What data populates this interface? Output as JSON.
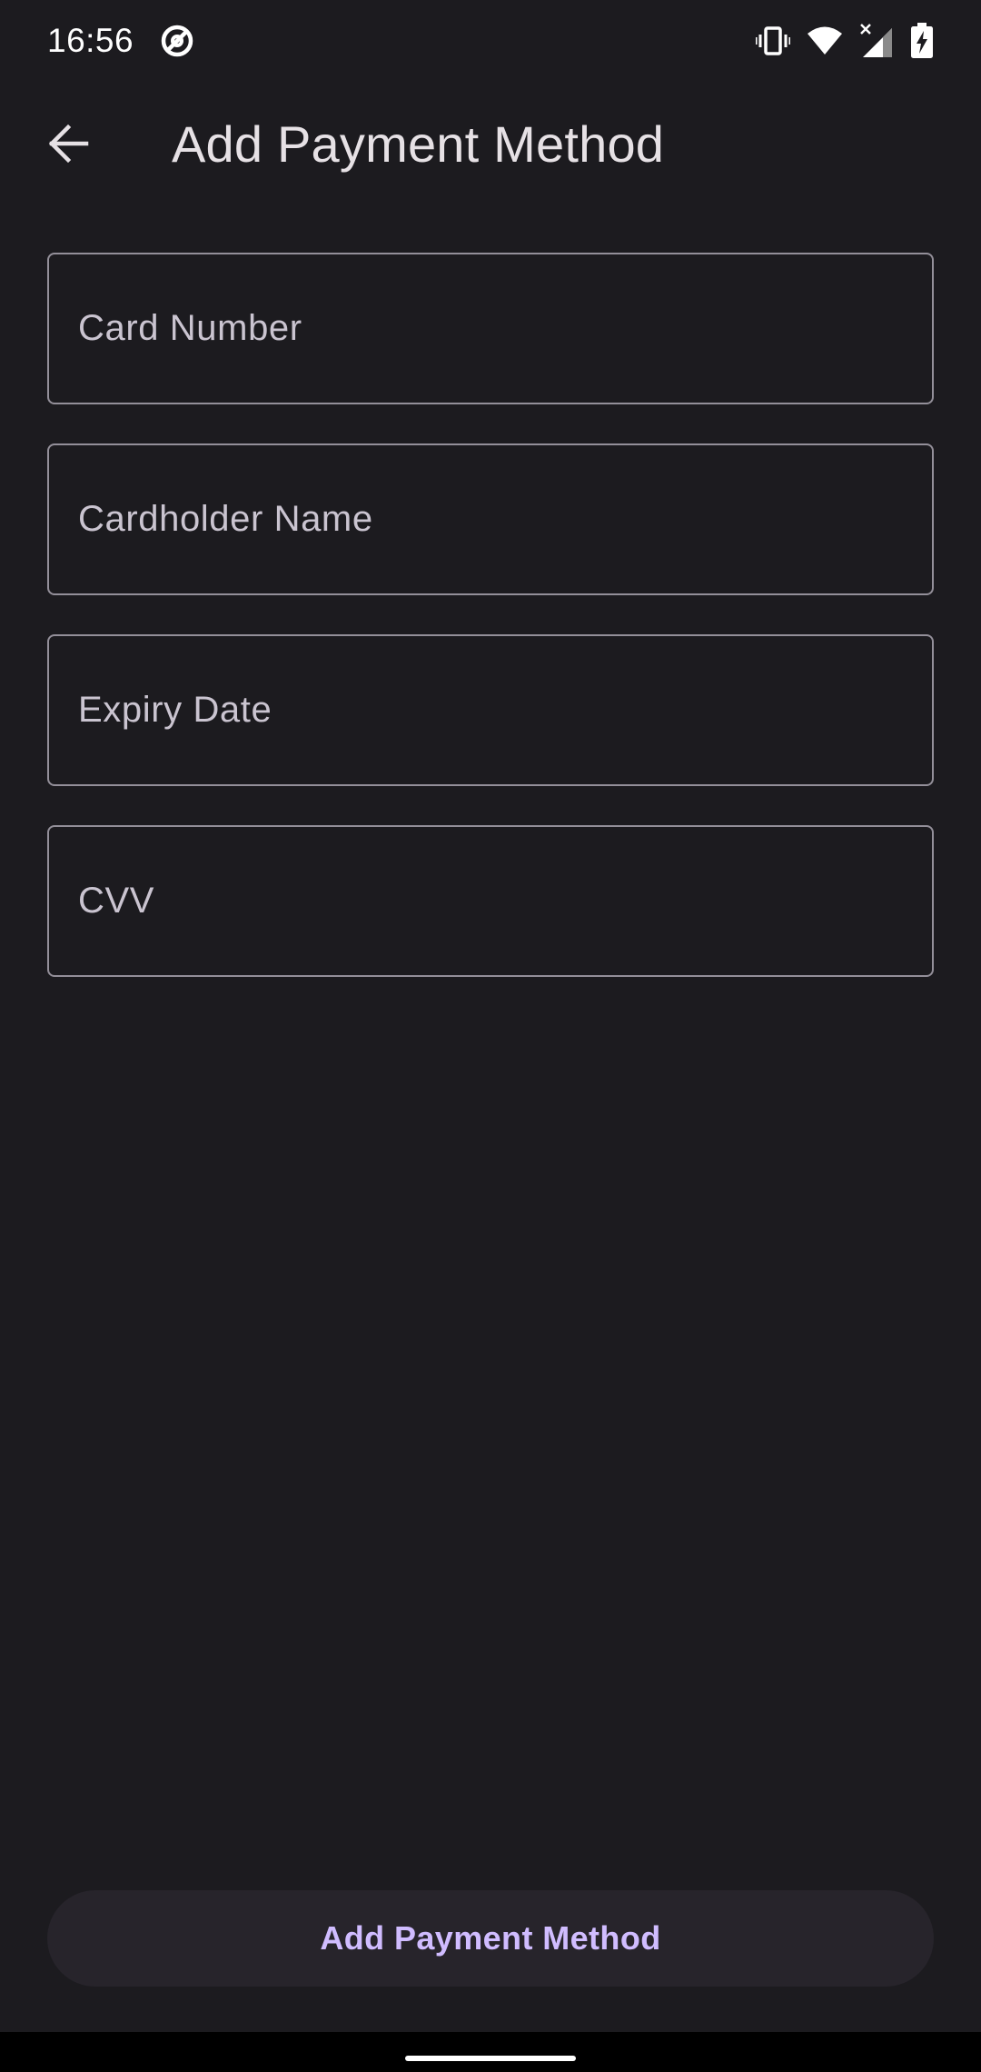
{
  "status_bar": {
    "time": "16:56",
    "icons": [
      "assistant-icon",
      "vibrate-icon",
      "wifi-icon",
      "cell-signal-icon",
      "battery-charging-icon"
    ]
  },
  "app_bar": {
    "back_icon": "arrow-back-icon",
    "title": "Add Payment Method"
  },
  "form": {
    "card_number": {
      "placeholder": "Card Number",
      "value": ""
    },
    "cardholder_name": {
      "placeholder": "Cardholder Name",
      "value": ""
    },
    "expiry_date": {
      "placeholder": "Expiry Date",
      "value": ""
    },
    "cvv": {
      "placeholder": "CVV",
      "value": ""
    }
  },
  "submit_button": {
    "label": "Add Payment Method"
  },
  "colors": {
    "background": "#1c1b1f",
    "outline": "#938f99",
    "accent": "#d0bcff",
    "button_surface": "#27242b",
    "text": "#e6e1e5"
  }
}
